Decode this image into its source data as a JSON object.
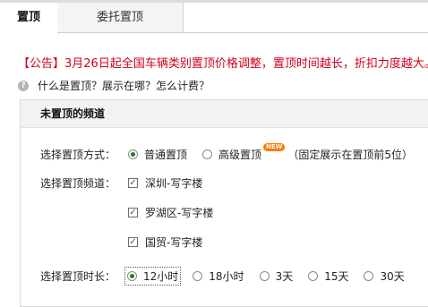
{
  "tabs": [
    {
      "label": "置顶",
      "active": true
    },
    {
      "label": "委托置顶",
      "active": false
    }
  ],
  "notice": "【公告】3月26日起全国车辆类别置顶价格调整，置顶时间越长，折扣力度越大。",
  "help_link": "什么是置顶？展示在哪？怎么计费？",
  "panel": {
    "title": "未置顶的频道",
    "mode": {
      "label": "选择置顶方式：",
      "options": [
        {
          "label": "普通置顶",
          "checked": true
        },
        {
          "label": "高级置顶",
          "checked": false
        }
      ],
      "badge": "NEW",
      "note": "（固定展示在置顶前5位）"
    },
    "channels": {
      "label": "选择置顶频道：",
      "items": [
        {
          "label": "深圳-写字楼",
          "checked": true
        },
        {
          "label": "罗湖区-写字楼",
          "checked": true
        },
        {
          "label": "国贸-写字楼",
          "checked": true
        }
      ]
    },
    "duration": {
      "label": "选择置顶时长：",
      "options": [
        {
          "label": "12小时",
          "checked": true
        },
        {
          "label": "18小时",
          "checked": false
        },
        {
          "label": "3天",
          "checked": false
        },
        {
          "label": "15天",
          "checked": false
        },
        {
          "label": "30天",
          "checked": false
        }
      ]
    }
  },
  "colors": {
    "notice": "#d0021b",
    "check": "#1c7a1c",
    "badge": "#ff7a00"
  }
}
